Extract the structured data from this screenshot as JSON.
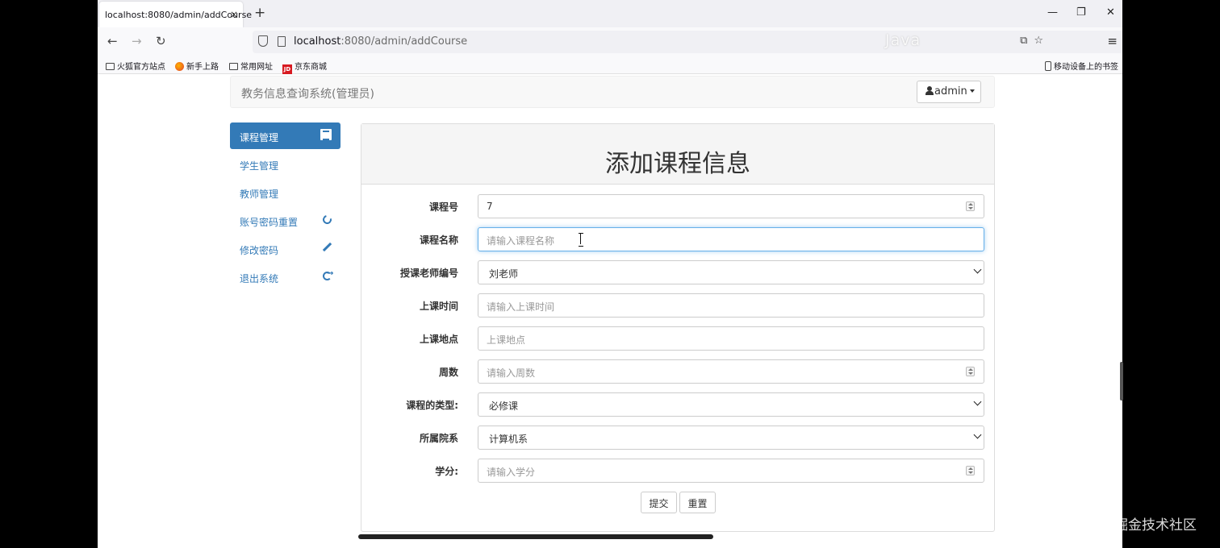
{
  "browser": {
    "tab_title": "localhost:8080/admin/addCourse",
    "tab_close": "×",
    "new_tab": "+",
    "url_host": "localhost",
    "url_rest": ":8080/admin/addCourse",
    "bookmarks": [
      "火狐官方站点",
      "新手上路",
      "常用网址",
      "京东商城"
    ],
    "mobile_bookmarks": "移动设备上的书签",
    "overlay_text": "Java"
  },
  "header": {
    "brand": "教务信息查询系统(管理员)",
    "user": "admin"
  },
  "sidebar": {
    "items": [
      {
        "label": "课程管理",
        "icon": "book-icon",
        "active": true
      },
      {
        "label": "学生管理"
      },
      {
        "label": "教师管理"
      },
      {
        "label": "账号密码重置",
        "icon": "refresh-icon"
      },
      {
        "label": "修改密码",
        "icon": "pencil-icon"
      },
      {
        "label": "退出系统",
        "icon": "logout-icon"
      }
    ]
  },
  "form": {
    "title": "添加课程信息",
    "fields": [
      {
        "label": "课程号",
        "value": "7",
        "type": "number"
      },
      {
        "label": "课程名称",
        "placeholder": "请输入课程名称",
        "type": "text",
        "focused": true
      },
      {
        "label": "授课老师编号",
        "value": "刘老师",
        "type": "select"
      },
      {
        "label": "上课时间",
        "placeholder": "请输入上课时间",
        "type": "text"
      },
      {
        "label": "上课地点",
        "placeholder": "上课地点",
        "type": "text"
      },
      {
        "label": "周数",
        "placeholder": "请输入周数",
        "type": "number"
      },
      {
        "label": "课程的类型:",
        "value": "必修课",
        "type": "select"
      },
      {
        "label": "所属院系",
        "value": "计算机系",
        "type": "select"
      },
      {
        "label": "学分:",
        "placeholder": "请输入学分",
        "type": "number"
      }
    ],
    "submit": "提交",
    "reset": "重置"
  },
  "watermark": "@稀土掘金技术社区",
  "colors": {
    "primary": "#337ab7",
    "focus": "#66afe9"
  }
}
